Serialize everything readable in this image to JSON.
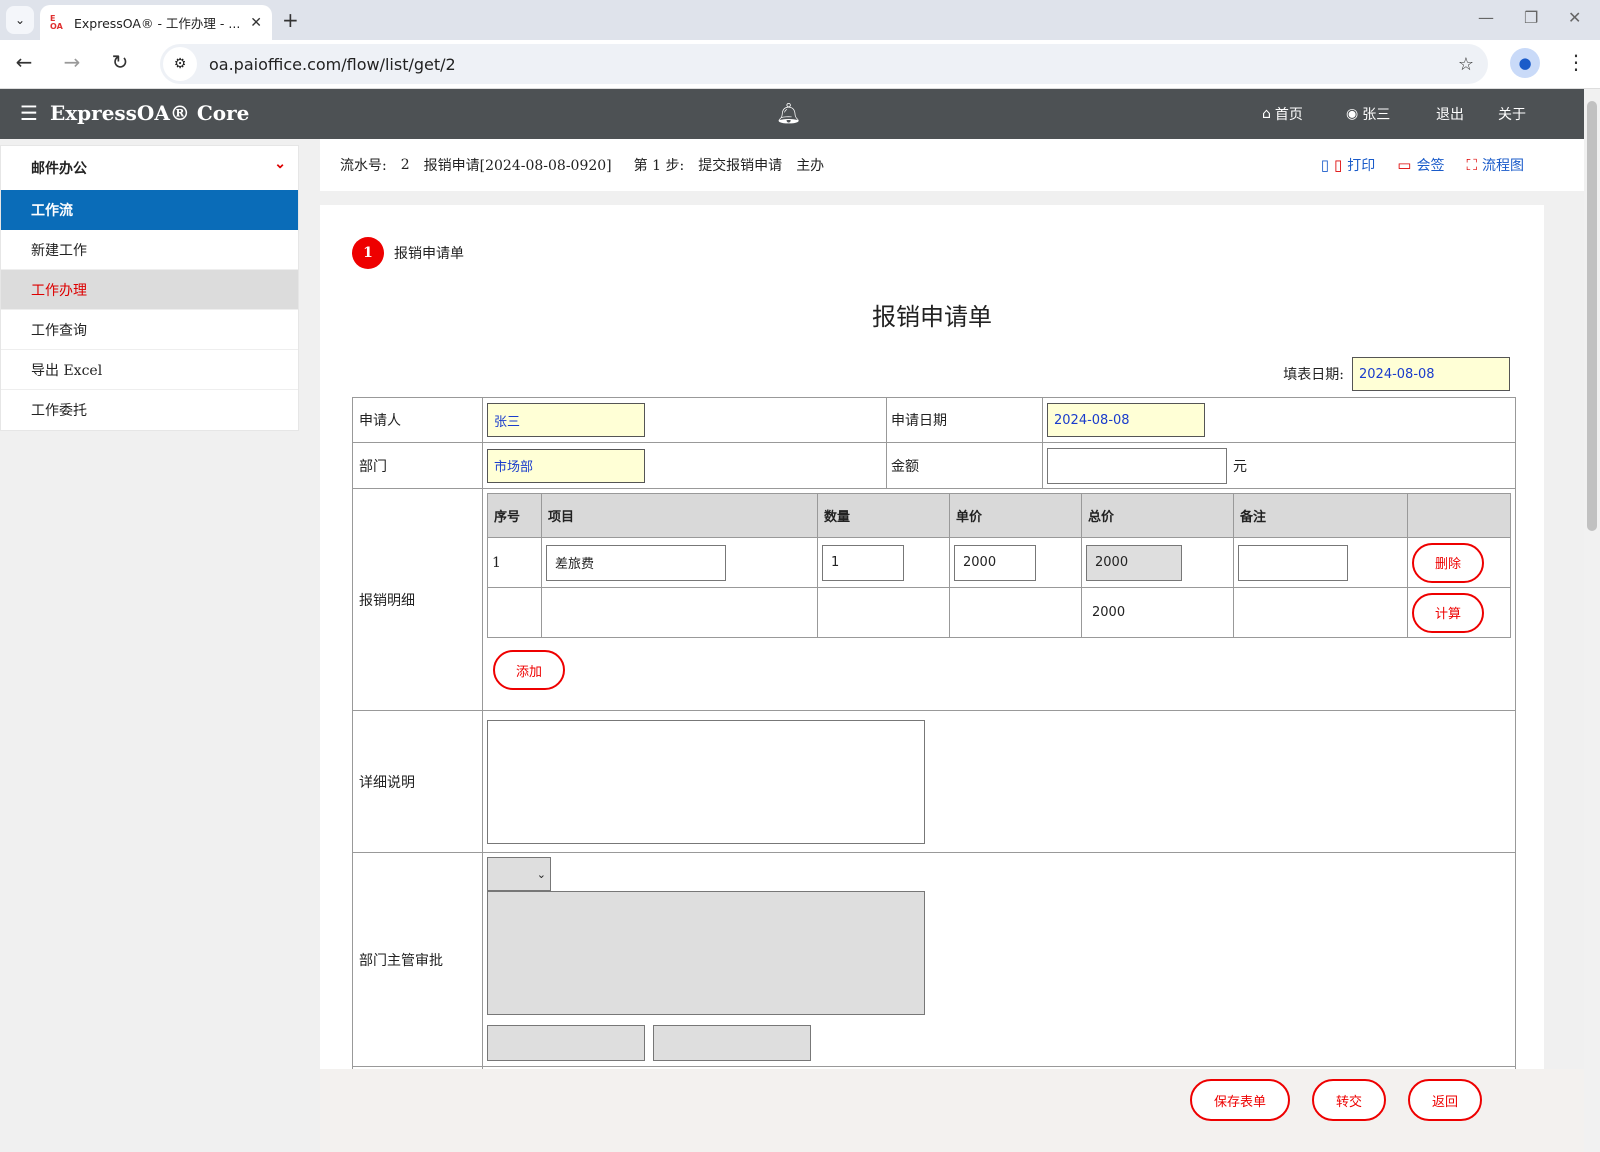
{
  "browser": {
    "tab_title": "ExpressOA® - 工作办理 - ...",
    "url": "oa.paioffice.com/flow/list/get/2"
  },
  "header": {
    "brand": "ExpressOA® Core",
    "nav": {
      "home": "首页",
      "user": "张三",
      "logout": "退出",
      "about": "关于"
    }
  },
  "sidebar": {
    "group": "邮件办公",
    "active": "工作流",
    "items": [
      "新建工作",
      "工作办理",
      "工作查询",
      "导出 Excel",
      "工作委托"
    ]
  },
  "infobar": {
    "serial_label": "流水号:",
    "serial_value": "2",
    "title": "报销申请[2024-08-08-0920]",
    "step_label": "第 1 步:",
    "step_name": "提交报销申请",
    "role": "主办",
    "print": "打印",
    "countersign": "会签",
    "flowchart": "流程图"
  },
  "form": {
    "step_number": "1",
    "step_title": "报销申请单",
    "title": "报销申请单",
    "fill_date_label": "填表日期:",
    "fill_date": "2024-08-08",
    "applicant_label": "申请人",
    "applicant": "张三",
    "apply_date_label": "申请日期",
    "apply_date": "2024-08-08",
    "dept_label": "部门",
    "dept": "市场部",
    "amount_label": "金额",
    "amount": "",
    "amount_unit": "元",
    "detail_label": "报销明细",
    "detail_headers": [
      "序号",
      "项目",
      "数量",
      "单价",
      "总价",
      "备注",
      ""
    ],
    "detail_row": {
      "no": "1",
      "item": "差旅费",
      "qty": "1",
      "price": "2000",
      "total": "2000",
      "remark": ""
    },
    "detail_sum": "2000",
    "delete_btn": "删除",
    "calc_btn": "计算",
    "add_btn": "添加",
    "desc_label": "详细说明",
    "approval_label": "部门主管审批"
  },
  "footer": {
    "save": "保存表单",
    "transfer": "转交",
    "back": "返回"
  }
}
